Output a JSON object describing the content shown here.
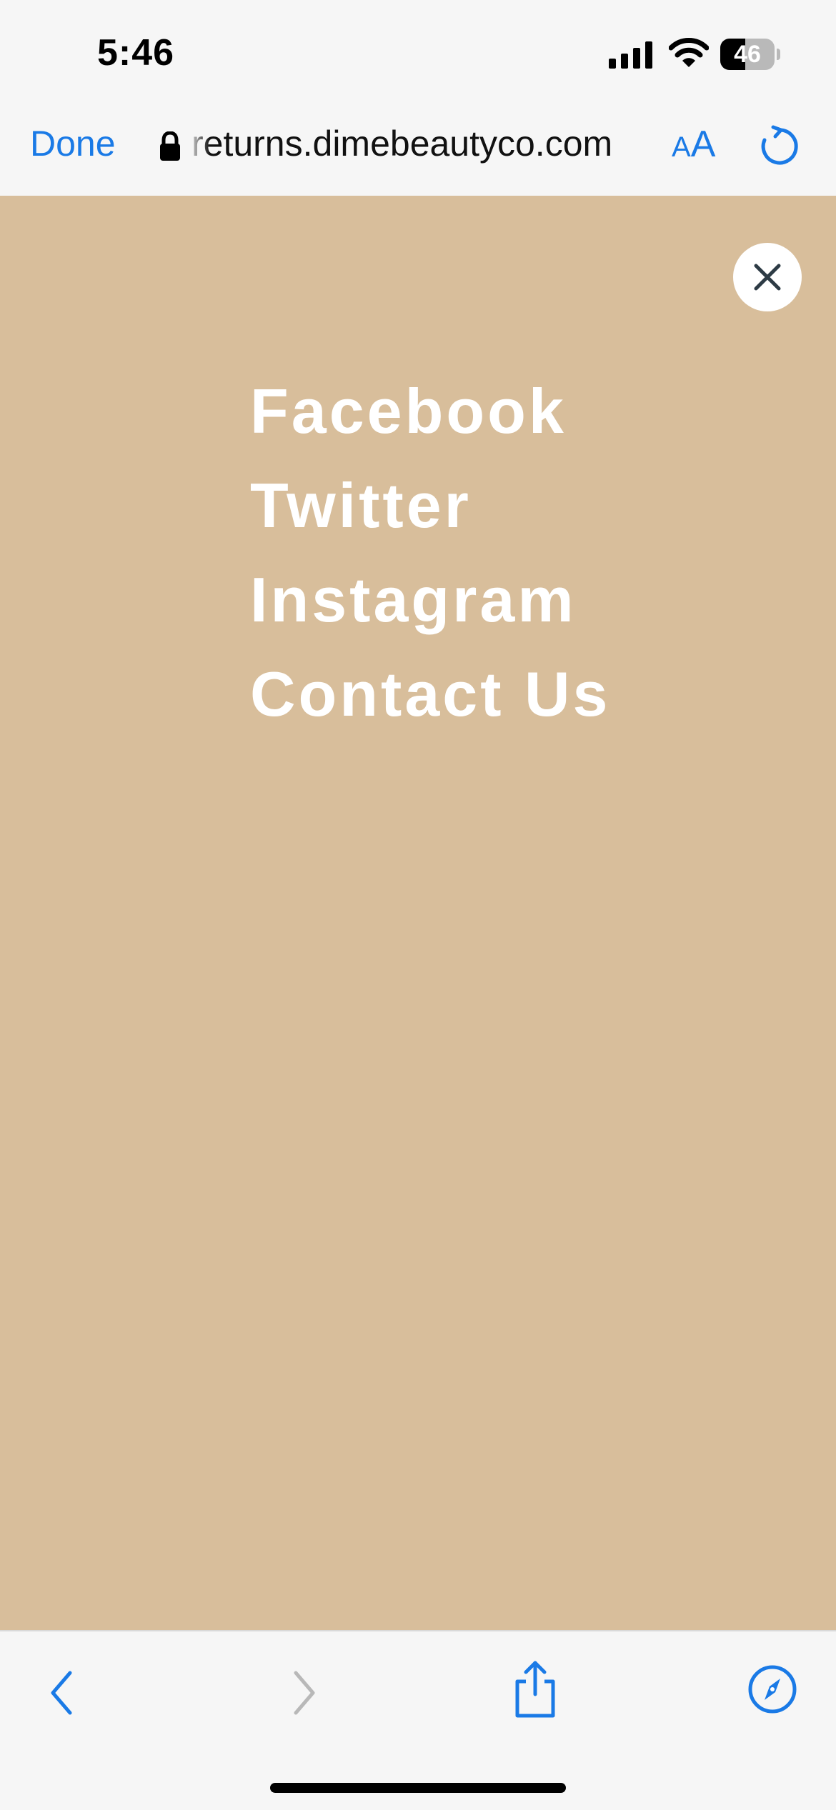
{
  "status_bar": {
    "time": "5:46",
    "battery_percent_text": "46",
    "battery_level": 0.46
  },
  "browser": {
    "done_label": "Done",
    "url": "returns.dimebeautyco.com",
    "text_size_small": "A",
    "text_size_large": "A"
  },
  "menu": {
    "items": [
      "Facebook",
      "Twitter",
      "Instagram",
      "Contact Us"
    ]
  },
  "colors": {
    "accent": "#1a7ae6",
    "overlay_background": "#d8be9b",
    "menu_text": "#ffffff"
  }
}
